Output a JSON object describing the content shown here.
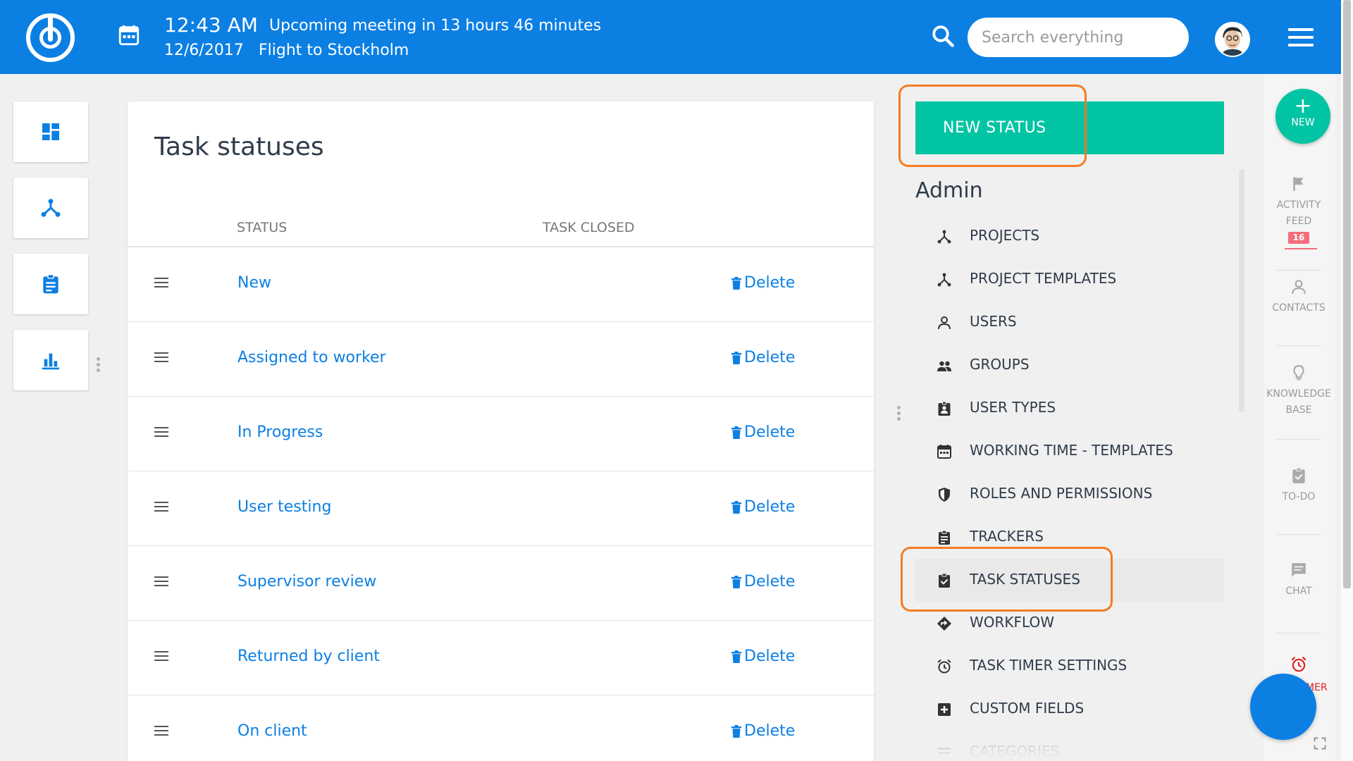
{
  "header": {
    "time": "12:43 AM",
    "date": "12/6/2017",
    "meeting_notice": "Upcoming meeting in 13 hours 46 minutes",
    "event": "Flight to Stockholm",
    "search_placeholder": "Search everything",
    "brand_color": "#0c7fe3"
  },
  "left_nav": {
    "items": [
      {
        "icon": "dashboard-icon"
      },
      {
        "icon": "projects-icon"
      },
      {
        "icon": "tasks-icon"
      },
      {
        "icon": "reports-icon"
      }
    ]
  },
  "main": {
    "title": "Task statuses",
    "columns": {
      "status": "STATUS",
      "task_closed": "TASK CLOSED"
    },
    "delete_label": "Delete",
    "rows": [
      {
        "name": "New"
      },
      {
        "name": "Assigned to worker"
      },
      {
        "name": "In Progress"
      },
      {
        "name": "User testing"
      },
      {
        "name": "Supervisor review"
      },
      {
        "name": "Returned by client"
      },
      {
        "name": "On client"
      }
    ]
  },
  "admin": {
    "new_button": "NEW STATUS",
    "title": "Admin",
    "menu": [
      {
        "label": "PROJECTS",
        "icon": "projects-icon"
      },
      {
        "label": "PROJECT TEMPLATES",
        "icon": "projects-icon"
      },
      {
        "label": "USERS",
        "icon": "user-icon"
      },
      {
        "label": "GROUPS",
        "icon": "groups-icon"
      },
      {
        "label": "USER TYPES",
        "icon": "badge-icon"
      },
      {
        "label": "WORKING TIME - TEMPLATES",
        "icon": "calendar-icon"
      },
      {
        "label": "ROLES AND PERMISSIONS",
        "icon": "shield-icon"
      },
      {
        "label": "TRACKERS",
        "icon": "clipboard-icon"
      },
      {
        "label": "TASK STATUSES",
        "icon": "clipboard-check-icon",
        "active": true
      },
      {
        "label": "WORKFLOW",
        "icon": "workflow-icon"
      },
      {
        "label": "TASK TIMER SETTINGS",
        "icon": "alarm-icon"
      },
      {
        "label": "CUSTOM FIELDS",
        "icon": "plus-box-icon"
      },
      {
        "label": "CATEGORIES",
        "icon": "categories-icon"
      }
    ],
    "accent_color": "#00c4a3",
    "highlight_color": "#f47c20"
  },
  "right_rail": {
    "new_label": "NEW",
    "activity_feed": "ACTIVITY FEED",
    "activity_badge": "16",
    "contacts": "CONTACTS",
    "knowledge_base": "KNOWLEDGE BASE",
    "todo": "TO-DO",
    "chat": "CHAT",
    "timer_partial": "MER"
  }
}
